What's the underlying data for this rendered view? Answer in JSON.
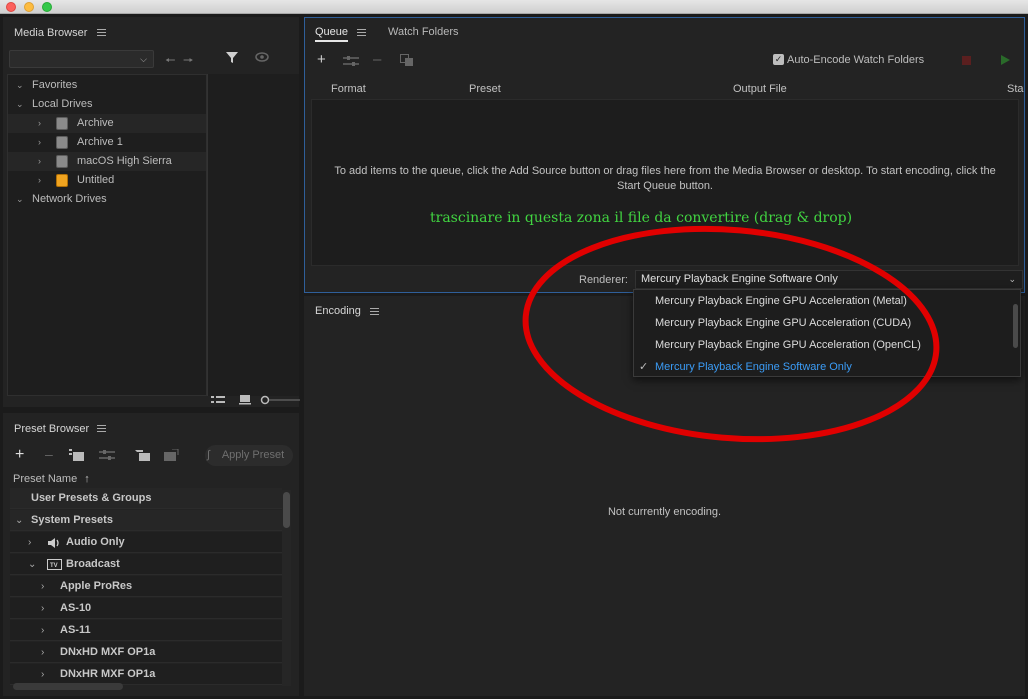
{
  "media_browser": {
    "title": "Media Browser",
    "tree": [
      {
        "label": "Favorites",
        "level": 0
      },
      {
        "label": "Local Drives",
        "level": 0
      },
      {
        "label": "Archive",
        "level": 1,
        "drive": "disk"
      },
      {
        "label": "Archive 1",
        "level": 1,
        "drive": "disk"
      },
      {
        "label": "macOS High Sierra",
        "level": 1,
        "drive": "disk"
      },
      {
        "label": "Untitled",
        "level": 1,
        "drive": "external-orange"
      },
      {
        "label": "Network Drives",
        "level": 0
      }
    ]
  },
  "preset_browser": {
    "title": "Preset Browser",
    "apply_preset_label": "Apply Preset",
    "column_header": "Preset Name",
    "sort_indicator": "↑",
    "rows": [
      {
        "label": "User Presets & Groups",
        "indent": 0,
        "arrow": ""
      },
      {
        "label": "System Presets",
        "indent": 0,
        "arrow": "v"
      },
      {
        "label": "Audio Only",
        "indent": 1,
        "arrow": ">",
        "icon": "speaker-icon"
      },
      {
        "label": "Broadcast",
        "indent": 1,
        "arrow": "v",
        "icon": "tv-icon"
      },
      {
        "label": "Apple ProRes",
        "indent": 2,
        "arrow": ">"
      },
      {
        "label": "AS-10",
        "indent": 2,
        "arrow": ">"
      },
      {
        "label": "AS-11",
        "indent": 2,
        "arrow": ">"
      },
      {
        "label": "DNxHD MXF OP1a",
        "indent": 2,
        "arrow": ">"
      },
      {
        "label": "DNxHR MXF OP1a",
        "indent": 2,
        "arrow": ">"
      }
    ]
  },
  "queue": {
    "tabs": [
      "Queue",
      "Watch Folders"
    ],
    "auto_encode_label": "Auto-Encode Watch Folders",
    "columns": [
      "Format",
      "Preset",
      "Output File",
      "Sta"
    ],
    "empty_message": "To add items to the queue, click the Add Source button or drag files here from the Media Browser or desktop.  To start encoding, click the Start Queue button.",
    "drag_note": "trascinare in questa zona il file da convertire (drag & drop)",
    "renderer_label": "Renderer:",
    "renderer_value": "Mercury Playback Engine Software Only"
  },
  "renderer_dropdown": {
    "options": [
      {
        "label": "Mercury Playback Engine GPU Acceleration (Metal)",
        "checked": false
      },
      {
        "label": "Mercury Playback Engine GPU Acceleration (CUDA)",
        "checked": false
      },
      {
        "label": "Mercury Playback Engine GPU Acceleration (OpenCL)",
        "checked": false
      },
      {
        "label": "Mercury Playback Engine Software Only",
        "checked": true
      }
    ]
  },
  "encoding": {
    "title": "Encoding",
    "status": "Not currently encoding."
  },
  "colors": {
    "background": "#1b1b1b",
    "panel": "#232323",
    "focus_border": "#2f5f9a",
    "selected_option": "#3b9cf6",
    "annotation_text": "#41d441",
    "annotation_ellipse": "#e00000"
  }
}
